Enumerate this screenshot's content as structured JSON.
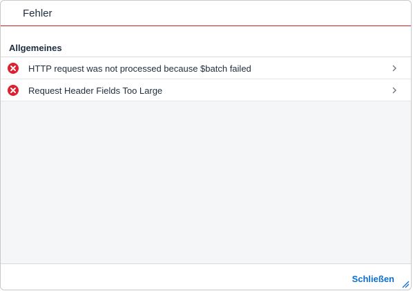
{
  "dialog": {
    "title": "Fehler"
  },
  "group": {
    "title": "Allgemeines"
  },
  "messages": [
    {
      "text": "HTTP request was not processed because $batch failed",
      "icon": "error-icon",
      "type": "error"
    },
    {
      "text": "Request Header Fields Too Large",
      "icon": "error-icon",
      "type": "error"
    }
  ],
  "footer": {
    "close_label": "Schließen"
  },
  "colors": {
    "error": "#e0202e",
    "accent": "#0a6ed1",
    "header_border": "#d81b1b"
  }
}
